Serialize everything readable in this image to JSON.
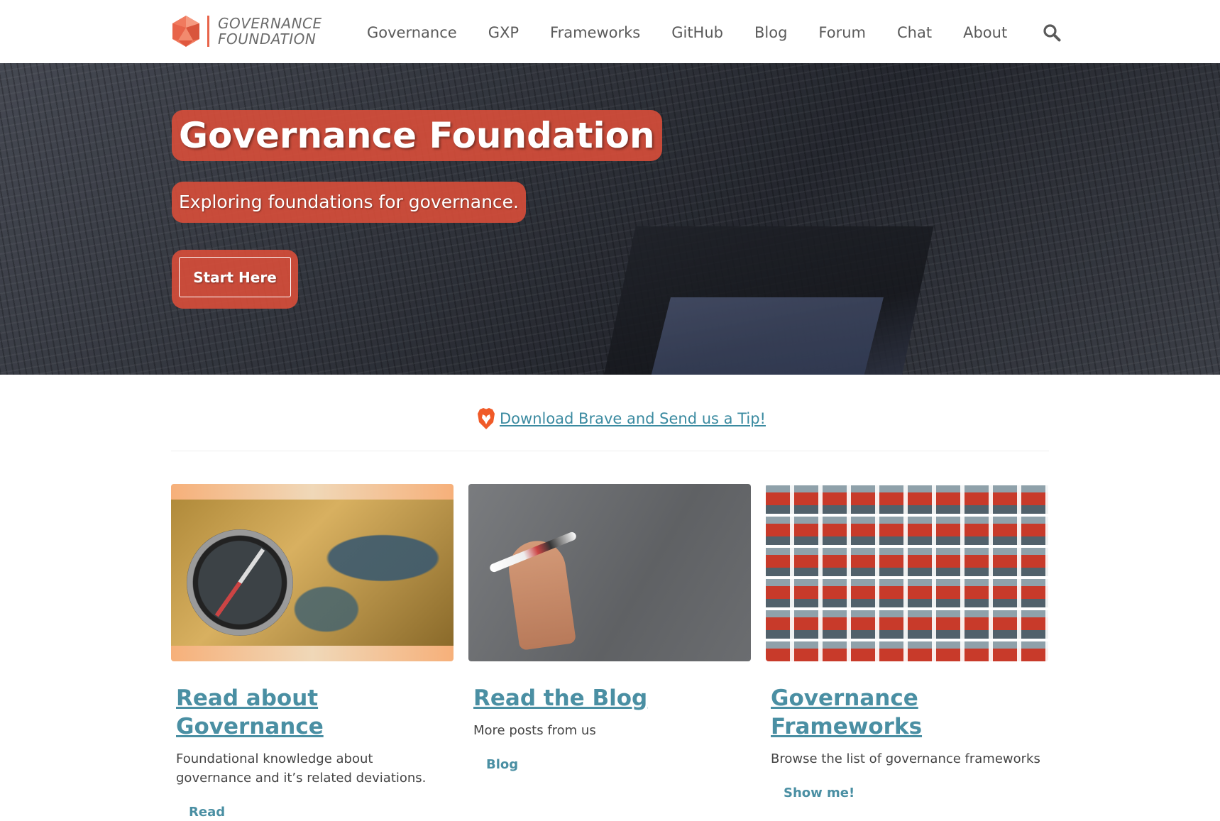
{
  "header": {
    "logo_line1": "GOVERNANCE",
    "logo_line2": "FOUNDATION",
    "nav": [
      "Governance",
      "GXP",
      "Frameworks",
      "GitHub",
      "Blog",
      "Forum",
      "Chat",
      "About"
    ],
    "search_icon": "search-icon"
  },
  "hero": {
    "title": "Governance Foundation",
    "subtitle": "Exploring foundations for governance.",
    "cta_label": "Start Here"
  },
  "tip": {
    "icon": "brave-lion-icon",
    "label": " Download Brave and Send us a Tip!"
  },
  "cards": [
    {
      "title": "Read about Governance",
      "description": "Foundational knowledge about governance and it’s related deviations.",
      "link": "Read"
    },
    {
      "title": "Read the Blog",
      "description": "More posts from us",
      "link": "Blog"
    },
    {
      "title": "Governance Frameworks",
      "description": "Browse the list of governance frameworks",
      "link": "Show me!"
    }
  ],
  "colors": {
    "accent": "#d84e3a",
    "link": "#4a8fa3",
    "tip_link": "#3a8aa0",
    "logo_bar": "#e8644a"
  }
}
